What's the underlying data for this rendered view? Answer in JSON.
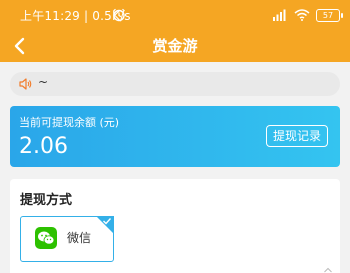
{
  "status_bar": {
    "time": "上午11:29 | 0.5K/s",
    "battery": "57",
    "icons": [
      "alarm-icon",
      "signal-icon",
      "wifi-icon",
      "battery-icon"
    ]
  },
  "app_bar": {
    "title": "赏金游",
    "back_icon": "chevron-left-icon"
  },
  "notice": {
    "icon": "speaker-icon",
    "text": "~"
  },
  "balance": {
    "label": "当前可提现余额 (元)",
    "value": "2.06",
    "record_button": "提现记录"
  },
  "withdraw_methods": {
    "title": "提现方式",
    "options": [
      {
        "label": "微信",
        "icon": "wechat-icon",
        "selected": true
      }
    ]
  },
  "colors": {
    "header": "#f5a623",
    "card_gradient_start": "#2aa6e9",
    "card_gradient_end": "#34c4f0",
    "selected_border": "#34b0e8",
    "wechat_green": "#2dc100"
  }
}
